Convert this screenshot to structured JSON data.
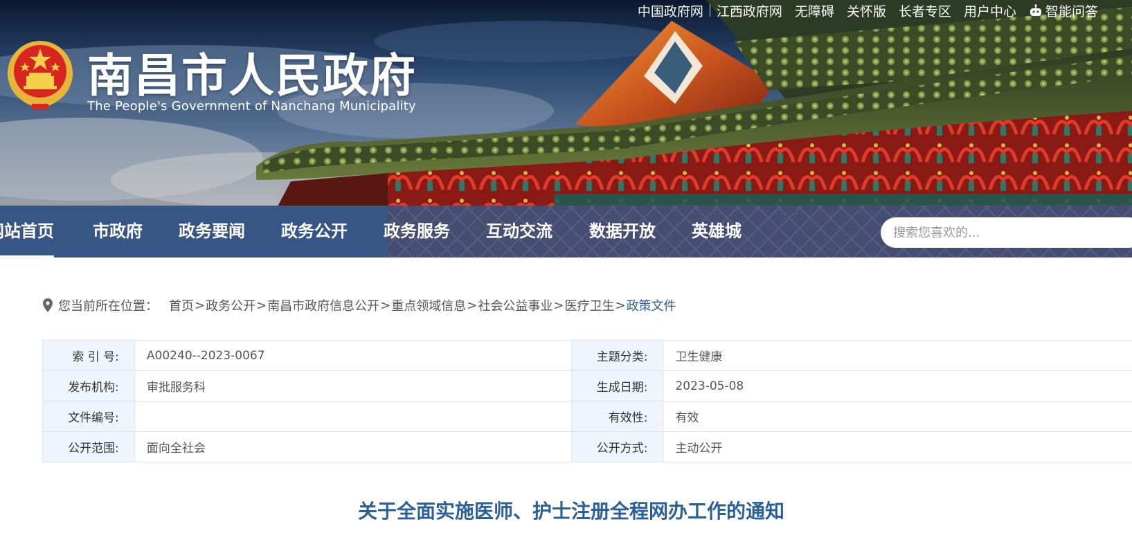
{
  "top_links": [
    "中国政府网",
    "江西政府网",
    "无障碍",
    "关怀版",
    "长者专区",
    "用户中心",
    "智能问答"
  ],
  "site": {
    "title": "南昌市人民政府",
    "subtitle": "The People's Government of Nanchang Municipality"
  },
  "nav": {
    "items": [
      "网站首页",
      "市政府",
      "政务要闻",
      "政务公开",
      "政务服务",
      "互动交流",
      "数据开放",
      "英雄城"
    ],
    "active": "网站首页"
  },
  "search": {
    "placeholder": "搜索您喜欢的..."
  },
  "breadcrumb": {
    "label": "您当前所在位置：",
    "items": [
      "首页",
      "政务公开",
      "南昌市政府信息公开",
      "重点领域信息",
      "社会公益事业",
      "医疗卫生",
      "政策文件"
    ],
    "separator": ">"
  },
  "info_table": [
    {
      "k1": "索 引 号:",
      "v1": "A00240--2023-0067",
      "k2": "主题分类:",
      "v2": "卫生健康"
    },
    {
      "k1": "发布机构:",
      "v1": "审批服务科",
      "k2": "生成日期:",
      "v2": "2023-05-08"
    },
    {
      "k1": "文件编号:",
      "v1": "",
      "k2": "有效性:",
      "v2": "有效"
    },
    {
      "k1": "公开范围:",
      "v1": "面向全社会",
      "k2": "公开方式:",
      "v2": "主动公开"
    }
  ],
  "article": {
    "title": "关于全面实施医师、护士注册全程网办工作的通知"
  },
  "icons": {
    "location": "map-pin-icon",
    "robot": "robot-icon",
    "emblem": "national-emblem"
  },
  "colors": {
    "nav_bg": "#325284",
    "accent_blue": "#2b5f9a",
    "table_key_bg": "#eef5fc"
  }
}
